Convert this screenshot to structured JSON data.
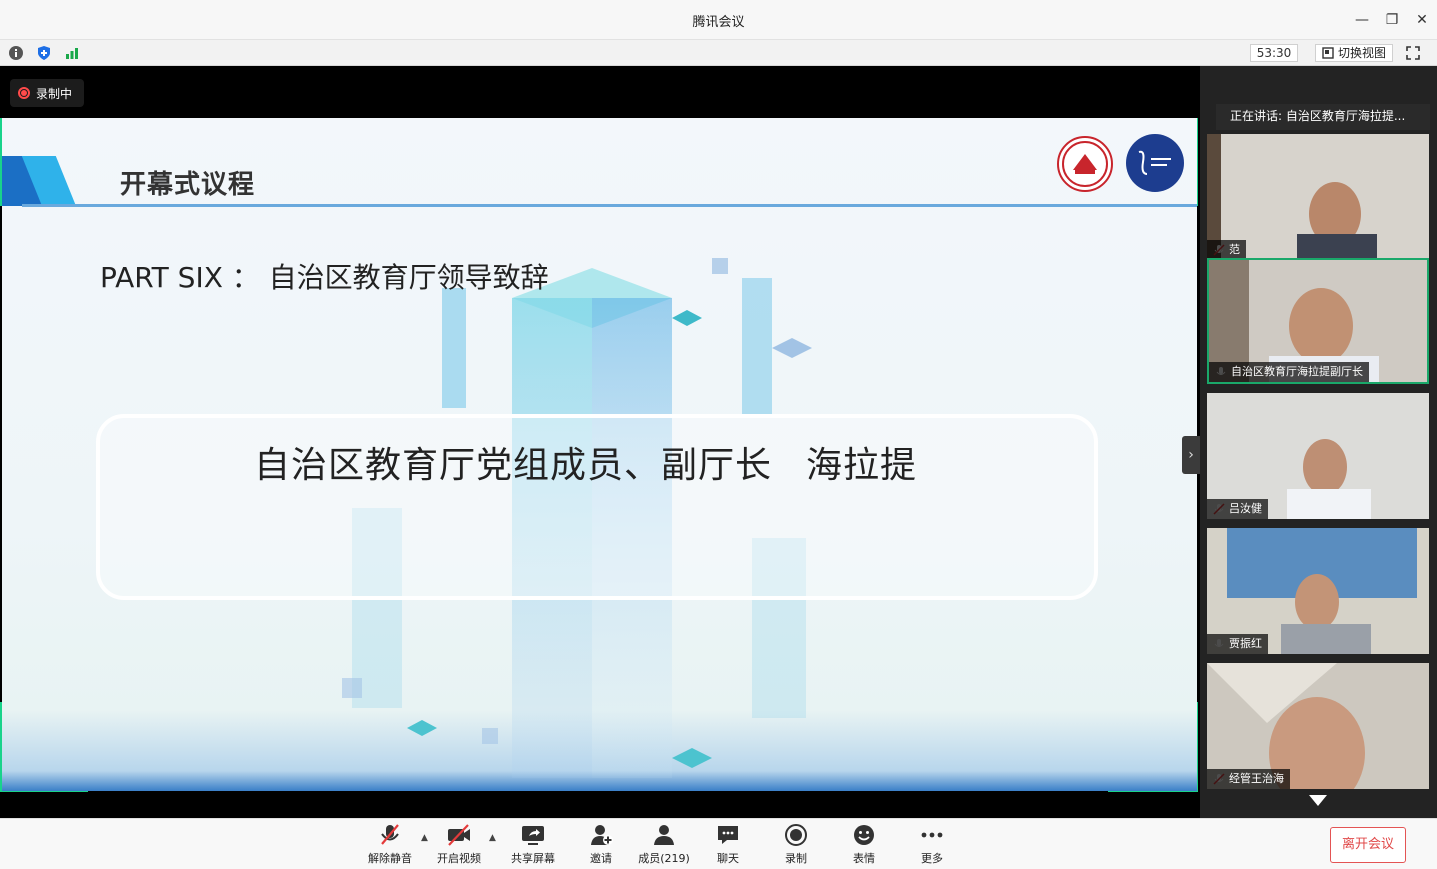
{
  "window": {
    "title": "腾讯会议"
  },
  "infobar": {
    "timer": "53:30",
    "switch_view": "切换视图"
  },
  "recording": {
    "label": "录制中"
  },
  "slide": {
    "agenda_title": "开幕式议程",
    "part_heading": "PART SIX ： 自治区教育厅领导致辞",
    "speaker_role": "自治区教育厅党组成员、副厅长",
    "speaker_name": "海拉提"
  },
  "sidebar": {
    "speaking": "正在讲话: 自治区教育厅海拉提...",
    "participants": [
      {
        "name": "范",
        "muted": true
      },
      {
        "name": "自治区教育厅海拉提副厅长",
        "muted": false,
        "active": true
      },
      {
        "name": "吕汝健",
        "muted": true
      },
      {
        "name": "贾振红",
        "muted": false
      },
      {
        "name": "经管王治海",
        "muted": true
      }
    ]
  },
  "toolbar": {
    "unmute": "解除静音",
    "video": "开启视频",
    "share": "共享屏幕",
    "invite": "邀请",
    "members": "成员(219)",
    "chat": "聊天",
    "record": "录制",
    "reaction": "表情",
    "more": "更多",
    "leave": "离开会议"
  },
  "colors": {
    "accent_green": "#19d38b",
    "leave_red": "#e04848",
    "slide_blue": "#1b6fc5"
  }
}
